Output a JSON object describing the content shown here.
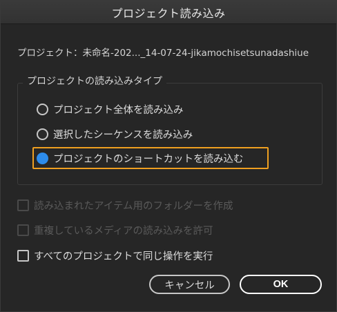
{
  "window": {
    "title": "プロジェクト読み込み"
  },
  "project": {
    "label": "プロジェクト：",
    "name": "未命名-202..._14-07-24-jikamochisetsunadashiue"
  },
  "import_type": {
    "legend": "プロジェクトの読み込みタイプ",
    "options": [
      {
        "label": "プロジェクト全体を読み込み",
        "selected": false
      },
      {
        "label": "選択したシーケンスを読み込み",
        "selected": false
      },
      {
        "label": "プロジェクトのショートカットを読み込む",
        "selected": true
      }
    ]
  },
  "options": [
    {
      "label": "読み込まれたアイテム用のフォルダーを作成",
      "enabled": false,
      "checked": false
    },
    {
      "label": "重複しているメディアの読み込みを許可",
      "enabled": false,
      "checked": false
    },
    {
      "label": "すべてのプロジェクトで同じ操作を実行",
      "enabled": true,
      "checked": false
    }
  ],
  "buttons": {
    "cancel": "キャンセル",
    "ok": "OK"
  },
  "colors": {
    "accent": "#2d8ceb",
    "focus": "#f0a020",
    "background": "#262626"
  }
}
